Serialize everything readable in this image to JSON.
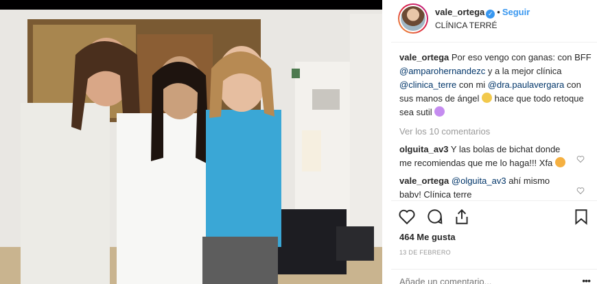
{
  "post": {
    "photo_icon": "photo-of-three-women",
    "account": {
      "username": "vale_ortega",
      "location": "CLÍNICA TERRÉ",
      "follow_label": "Seguir",
      "separator": "•"
    },
    "caption": {
      "username": "vale_ortega",
      "text1": "Por eso vengo con ganas: con BFF ",
      "mention1": "@amparohernandezc",
      "text2": " y a la mejor clínica ",
      "mention2": "@clinica_terre",
      "text3": " con mi ",
      "mention3": "@dra.paulavergara",
      "text4": " con sus manos de ángel ",
      "text5": " hace que todo retoque sea sutil "
    },
    "view_all_label": "Ver los 10 comentarios",
    "comments": [
      {
        "username": "olguita_av3",
        "text": "Y las bolas de bichat donde me recomiendas que me lo haga!!! Xfa "
      },
      {
        "username": "vale_ortega",
        "mention": "@olguita_av3",
        "text": " ahí mismo babv! Clínica terre"
      }
    ],
    "likes_label": "464 Me gusta",
    "date_label": "13 DE FEBRERO",
    "add_comment_placeholder": "Añade un comentario...",
    "more_label": "•••",
    "colors": {
      "link": "#003569",
      "accent": "#3897f0",
      "muted": "#999999"
    }
  }
}
